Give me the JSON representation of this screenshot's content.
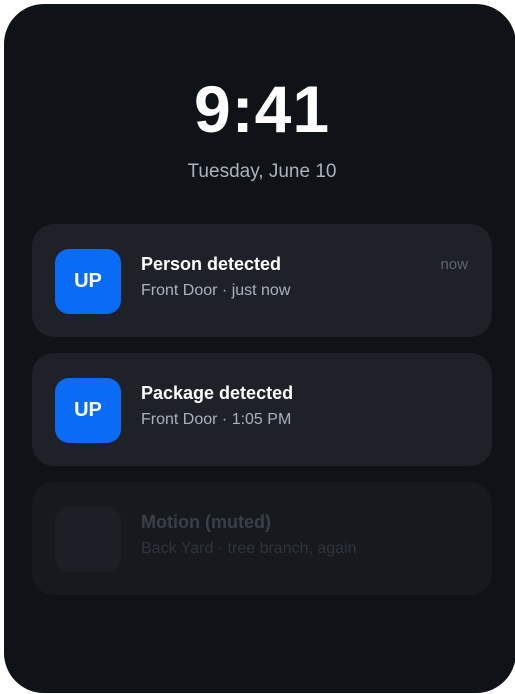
{
  "lockscreen": {
    "time": "9:41",
    "date": "Tuesday, June 10"
  },
  "notifications": [
    {
      "app_badge": "UP",
      "title": "Person detected",
      "subtitle": "Front Door · just now",
      "time": "now"
    },
    {
      "app_badge": "UP",
      "title": "Package detected",
      "subtitle": "Front Door · 1:05 PM"
    },
    {
      "title": "Motion (muted)",
      "subtitle": "Back Yard · tree branch, again"
    }
  ],
  "colors": {
    "background": "#0f1216",
    "card": "#1e2128",
    "muted_card": "#16191e",
    "accent": "#0a6cf5",
    "primary_text": "#ffffff",
    "secondary_text": "#aab2c0"
  }
}
